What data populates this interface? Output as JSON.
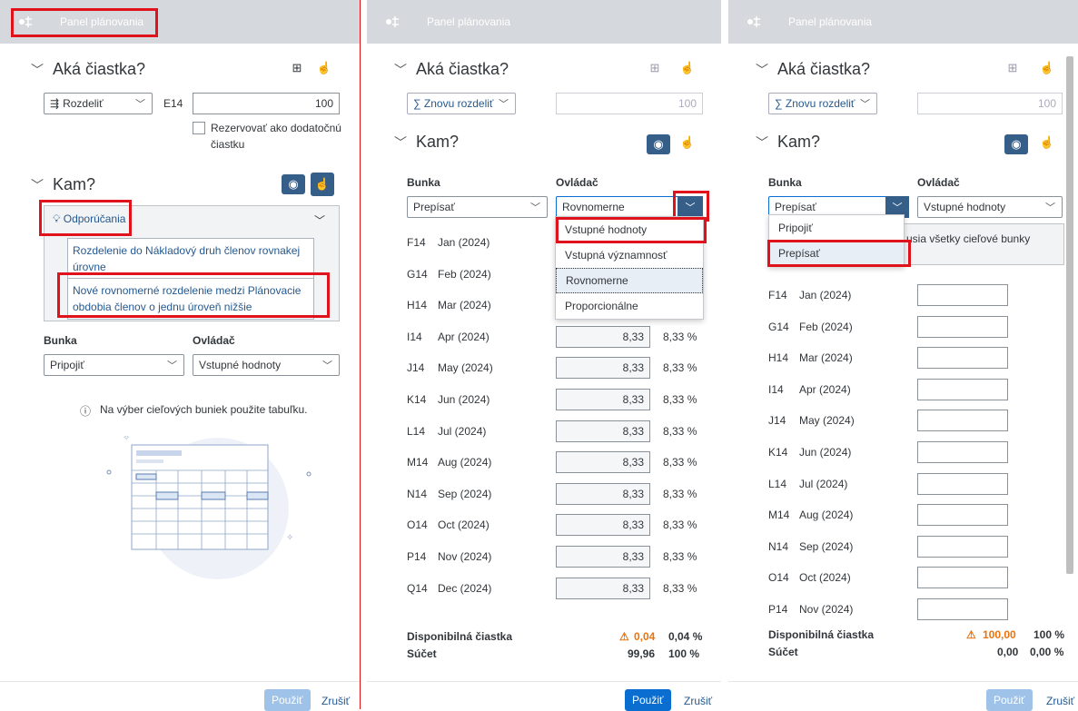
{
  "header": {
    "title": "Panel plánovania"
  },
  "p1": {
    "what": "Aká čiastka?",
    "method": "Rozdeliť",
    "cell_ref": "E14",
    "amount": "100",
    "reserve": "Rezervovať ako dodatočnú čiastku",
    "where": "Kam?",
    "reco_title": "Odporúčania",
    "reco1": "Rozdelenie do Nákladový druh členov rovnakej úrovne",
    "reco2": "Nové rovnomerné rozdelenie medzi Plánovacie obdobia členov o jednu úroveň nižšie",
    "cell_label": "Bunka",
    "driver_label": "Ovládač",
    "cell_value": "Pripojiť",
    "driver_value": "Vstupné hodnoty",
    "info": "Na výber cieľových buniek použite tabuľku.",
    "apply": "Použiť",
    "cancel": "Zrušiť"
  },
  "p2": {
    "what": "Aká čiastka?",
    "method": "∑ Znovu rozdeliť",
    "amount": "100",
    "where": "Kam?",
    "cell_label": "Bunka",
    "driver_label": "Ovládač",
    "cell_value": "Prepísať",
    "driver_value": "Rovnomerne",
    "menu": [
      "Vstupné hodnoty",
      "Vstupná významnosť",
      "Rovnomerne",
      "Proporcionálne"
    ],
    "rows": [
      {
        "cell": "F14",
        "period": "Jan (2024)",
        "value": "",
        "pct": ""
      },
      {
        "cell": "G14",
        "period": "Feb (2024)",
        "value": "",
        "pct": ""
      },
      {
        "cell": "H14",
        "period": "Mar (2024)",
        "value": "",
        "pct": ""
      },
      {
        "cell": "I14",
        "period": "Apr (2024)",
        "value": "8,33",
        "pct": "8,33 %"
      },
      {
        "cell": "J14",
        "period": "May (2024)",
        "value": "8,33",
        "pct": "8,33 %"
      },
      {
        "cell": "K14",
        "period": "Jun (2024)",
        "value": "8,33",
        "pct": "8,33 %"
      },
      {
        "cell": "L14",
        "period": "Jul (2024)",
        "value": "8,33",
        "pct": "8,33 %"
      },
      {
        "cell": "M14",
        "period": "Aug (2024)",
        "value": "8,33",
        "pct": "8,33 %"
      },
      {
        "cell": "N14",
        "period": "Sep (2024)",
        "value": "8,33",
        "pct": "8,33 %"
      },
      {
        "cell": "O14",
        "period": "Oct (2024)",
        "value": "8,33",
        "pct": "8,33 %"
      },
      {
        "cell": "P14",
        "period": "Nov (2024)",
        "value": "8,33",
        "pct": "8,33 %"
      },
      {
        "cell": "Q14",
        "period": "Dec (2024)",
        "value": "8,33",
        "pct": "8,33 %"
      }
    ],
    "avail_label": "Disponibilná čiastka",
    "avail_value": "0,04",
    "avail_pct": "0,04 %",
    "sum_label": "Súčet",
    "sum_value": "99,96",
    "sum_pct": "100 %",
    "apply": "Použiť",
    "cancel": "Zrušiť"
  },
  "p3": {
    "what": "Aká čiastka?",
    "method": "∑ Znovu rozdeliť",
    "amount": "100",
    "where": "Kam?",
    "cell_label": "Bunka",
    "driver_label": "Ovládač",
    "cell_value": "Prepísať",
    "driver_value": "Vstupné hodnoty",
    "menu": [
      "Pripojiť",
      "Prepísať"
    ],
    "notice": "usia všetky cieľové bunky",
    "rows": [
      {
        "cell": "F14",
        "period": "Jan (2024)"
      },
      {
        "cell": "G14",
        "period": "Feb (2024)"
      },
      {
        "cell": "H14",
        "period": "Mar (2024)"
      },
      {
        "cell": "I14",
        "period": "Apr (2024)"
      },
      {
        "cell": "J14",
        "period": "May (2024)"
      },
      {
        "cell": "K14",
        "period": "Jun (2024)"
      },
      {
        "cell": "L14",
        "period": "Jul (2024)"
      },
      {
        "cell": "M14",
        "period": "Aug (2024)"
      },
      {
        "cell": "N14",
        "period": "Sep (2024)"
      },
      {
        "cell": "O14",
        "period": "Oct (2024)"
      },
      {
        "cell": "P14",
        "period": "Nov (2024)"
      }
    ],
    "avail_label": "Disponibilná čiastka",
    "avail_value": "100,00",
    "avail_pct": "100 %",
    "sum_label": "Súčet",
    "sum_value": "0,00",
    "sum_pct": "0,00 %",
    "apply": "Použiť",
    "cancel": "Zrušiť"
  },
  "colors": {
    "accent": "#355e89",
    "button": "#0a6ed1",
    "highlight": "#e0121c",
    "warning": "#e9730c"
  }
}
